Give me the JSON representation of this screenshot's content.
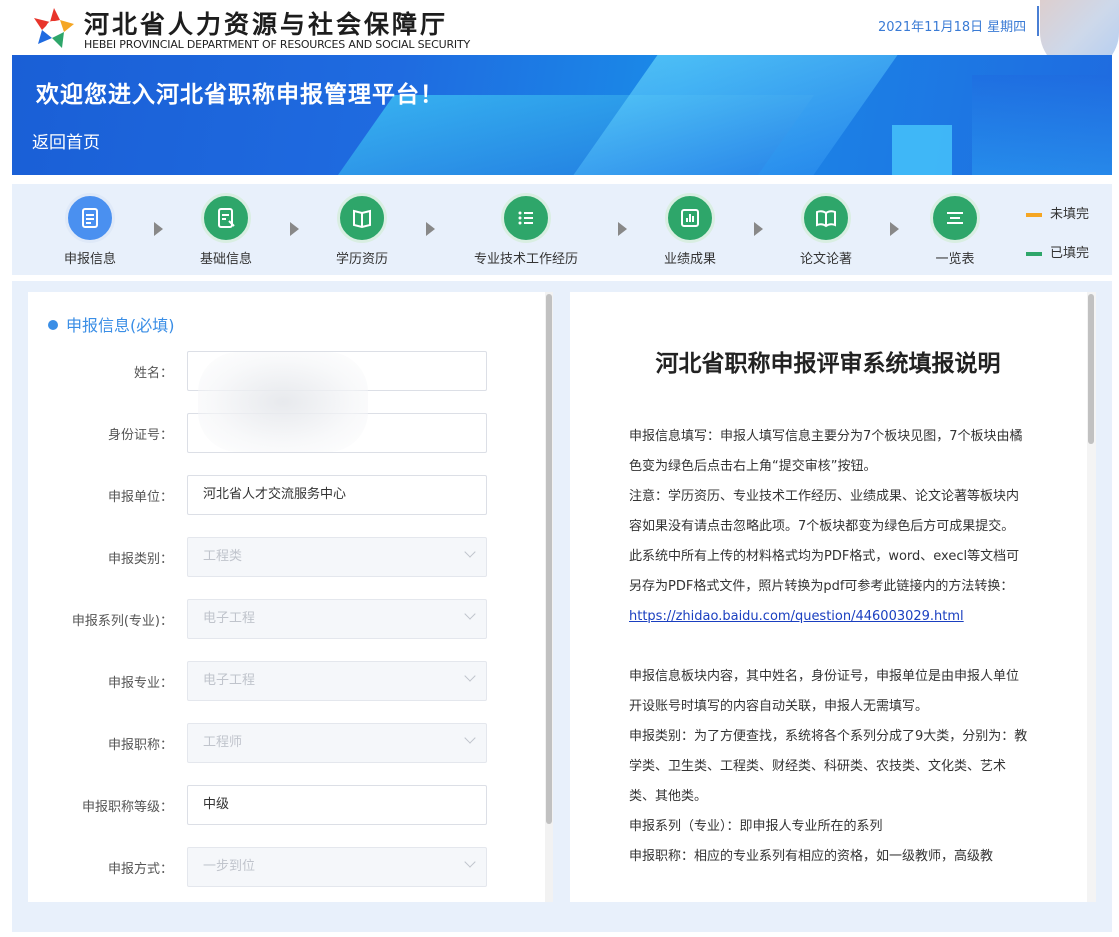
{
  "header": {
    "org_name_cn": "河北省人力资源与社会保障厅",
    "org_name_en": "HEBEI PROVINCIAL DEPARTMENT OF RESOURCES AND SOCIAL SECURITY",
    "date": "2021年11月18日",
    "weekday": "星期四"
  },
  "banner": {
    "title": "欢迎您进入河北省职称申报管理平台！",
    "back_link": "返回首页"
  },
  "steps": [
    {
      "label": "申报信息",
      "icon": "form-icon",
      "status": "current"
    },
    {
      "label": "基础信息",
      "icon": "edit-doc-icon",
      "status": "filled"
    },
    {
      "label": "学历资历",
      "icon": "book-icon",
      "status": "filled"
    },
    {
      "label": "专业技术工作经历",
      "icon": "list-icon",
      "status": "filled"
    },
    {
      "label": "业绩成果",
      "icon": "chart-icon",
      "status": "filled"
    },
    {
      "label": "论文论著",
      "icon": "open-book-icon",
      "status": "filled"
    },
    {
      "label": "一览表",
      "icon": "menu-icon",
      "status": "filled"
    }
  ],
  "legend": {
    "unfilled": "未填完",
    "filled": "已填完",
    "unfilled_color": "#f5a623",
    "filled_color": "#2ea66a"
  },
  "form": {
    "section_title": "申报信息(必填)",
    "fields": [
      {
        "label": "姓名：",
        "value": "",
        "disabled": false
      },
      {
        "label": "身份证号：",
        "value": "",
        "disabled": false
      },
      {
        "label": "申报单位：",
        "value": "河北省人才交流服务中心",
        "disabled": false
      },
      {
        "label": "申报类别：",
        "value": "工程类",
        "disabled": true
      },
      {
        "label": "申报系列(专业)：",
        "value": "电子工程",
        "disabled": true
      },
      {
        "label": "申报专业：",
        "value": "电子工程",
        "disabled": true
      },
      {
        "label": "申报职称：",
        "value": "工程师",
        "disabled": true
      },
      {
        "label": "申报职称等级：",
        "value": "中级",
        "disabled": false
      },
      {
        "label": "申报方式：",
        "value": "一步到位",
        "disabled": true
      }
    ]
  },
  "instructions": {
    "title": "河北省职称申报评审系统填报说明",
    "p1": "申报信息填写：申报人填写信息主要分为7个板块见图，7个板块由橘色变为绿色后点击右上角“提交审核”按钮。",
    "p2": "注意：学历资历、专业技术工作经历、业绩成果、论文论著等板块内容如果没有请点击忽略此项。7个板块都变为绿色后方可成果提交。",
    "p3": "此系统中所有上传的材料格式均为PDF格式，word、execl等文档可另存为PDF格式文件，照片转换为pdf可参考此链接内的方法转换：",
    "link": "https://zhidao.baidu.com/question/446003029.html",
    "p4": "申报信息板块内容，其中姓名，身份证号，申报单位是由申报人单位开设账号时填写的内容自动关联，申报人无需填写。",
    "p5": "申报类别：为了方便查找，系统将各个系列分成了9大类，分别为：教学类、卫生类、工程类、财经类、科研类、农技类、文化类、艺术类、其他类。",
    "p6": "申报系列（专业）：即申报人专业所在的系列",
    "p7": "申报职称：相应的专业系列有相应的资格，如一级教师，高级教"
  }
}
